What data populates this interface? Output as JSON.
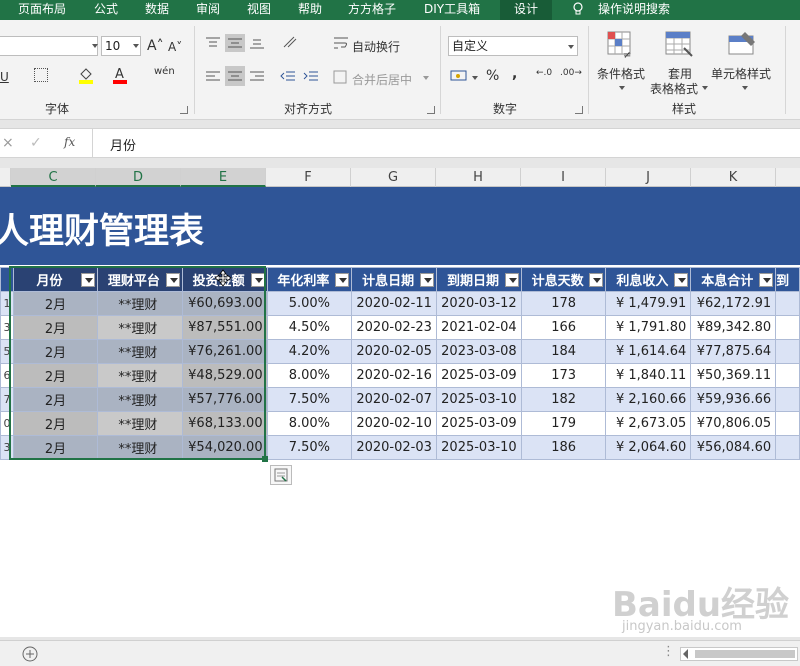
{
  "tabs": [
    "页面布局",
    "公式",
    "数据",
    "审阅",
    "视图",
    "帮助",
    "方方格子",
    "DIY工具箱",
    "设计",
    "操作说明搜索"
  ],
  "active_tab": "设计",
  "ribbon": {
    "font_size": "10",
    "font_group": "字体",
    "align_group": "对齐方式",
    "wrap_text": "自动换行",
    "merge_center": "合并后居中",
    "number_format": "自定义",
    "number_group": "数字",
    "cond_format": "条件格式",
    "table_format_1": "套用",
    "table_format_2": "表格格式",
    "cell_style": "单元格样式",
    "style_group": "样式"
  },
  "formula_bar": {
    "content": "月份",
    "fx": "fx"
  },
  "columns": [
    "C",
    "D",
    "E",
    "F",
    "G",
    "H",
    "I",
    "J",
    "K"
  ],
  "title": "人理财管理表",
  "headers": [
    "月份",
    "理财平台",
    "投资金额",
    "年化利率",
    "计息日期",
    "到期日期",
    "计息天数",
    "利息收入",
    "本息合计",
    "到"
  ],
  "row_nums": [
    "1",
    "3",
    "5",
    "6",
    "7",
    "0",
    "3"
  ],
  "rows": [
    [
      "2月",
      "**理财",
      "¥60,693.00",
      "5.00%",
      "2020-02-11",
      "2020-03-12",
      "178",
      "¥  1,479.91",
      "¥62,172.91"
    ],
    [
      "2月",
      "**理财",
      "¥87,551.00",
      "4.50%",
      "2020-02-23",
      "2021-02-04",
      "166",
      "¥  1,791.80",
      "¥89,342.80"
    ],
    [
      "2月",
      "**理财",
      "¥76,261.00",
      "4.20%",
      "2020-02-05",
      "2023-03-08",
      "184",
      "¥  1,614.64",
      "¥77,875.64"
    ],
    [
      "2月",
      "**理财",
      "¥48,529.00",
      "8.00%",
      "2020-02-16",
      "2025-03-09",
      "173",
      "¥  1,840.11",
      "¥50,369.11"
    ],
    [
      "2月",
      "**理财",
      "¥57,776.00",
      "7.50%",
      "2020-02-07",
      "2025-03-10",
      "182",
      "¥  2,160.66",
      "¥59,936.66"
    ],
    [
      "2月",
      "**理财",
      "¥68,133.00",
      "8.00%",
      "2020-02-10",
      "2025-03-09",
      "179",
      "¥  2,673.05",
      "¥70,806.05"
    ],
    [
      "2月",
      "**理财",
      "¥54,020.00",
      "7.50%",
      "2020-02-03",
      "2025-03-10",
      "186",
      "¥  2,064.60",
      "¥56,084.60"
    ]
  ],
  "watermark": {
    "brand": "Baidu经验",
    "url": "jingyan.baidu.com"
  },
  "colors": {
    "ribbon_green": "#217346",
    "table_header": "#2f5597",
    "band": "#dbe3f5"
  }
}
